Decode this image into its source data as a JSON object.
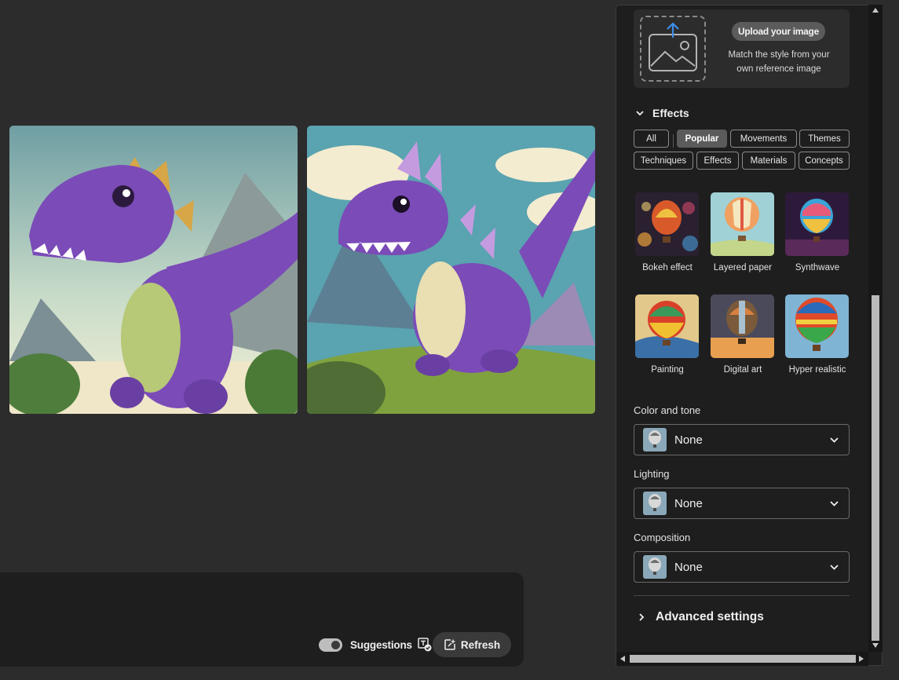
{
  "gallery": {
    "image_1": {
      "icon": "purple-dinosaur-image-soft-style"
    },
    "image_2": {
      "icon": "purple-dinosaur-image-cartoon-style"
    }
  },
  "prompt_bar": {
    "suggestions_label": "Suggestions",
    "suggestions_enabled": true,
    "refresh_label": "Refresh"
  },
  "panel": {
    "upload": {
      "button_label": "Upload your image",
      "description": "Match the style from your own reference image"
    },
    "effects": {
      "title": "Effects",
      "expanded": true,
      "filters": [
        "All",
        "Popular",
        "Movements",
        "Themes",
        "Techniques",
        "Effects",
        "Materials",
        "Concepts"
      ],
      "active_filter": "Popular",
      "items": [
        {
          "label": "Bokeh effect"
        },
        {
          "label": "Layered paper"
        },
        {
          "label": "Synthwave"
        },
        {
          "label": "Painting"
        },
        {
          "label": "Digital art"
        },
        {
          "label": "Hyper realistic"
        }
      ]
    },
    "color_and_tone": {
      "label": "Color and tone",
      "value": "None"
    },
    "lighting": {
      "label": "Lighting",
      "value": "None"
    },
    "composition": {
      "label": "Composition",
      "value": "None"
    },
    "advanced": {
      "label": "Advanced settings",
      "expanded": false
    }
  },
  "colors": {
    "background": "#2c2c2c",
    "panel": "#1e1e1e",
    "accent_purple": "#7b4bb8"
  }
}
